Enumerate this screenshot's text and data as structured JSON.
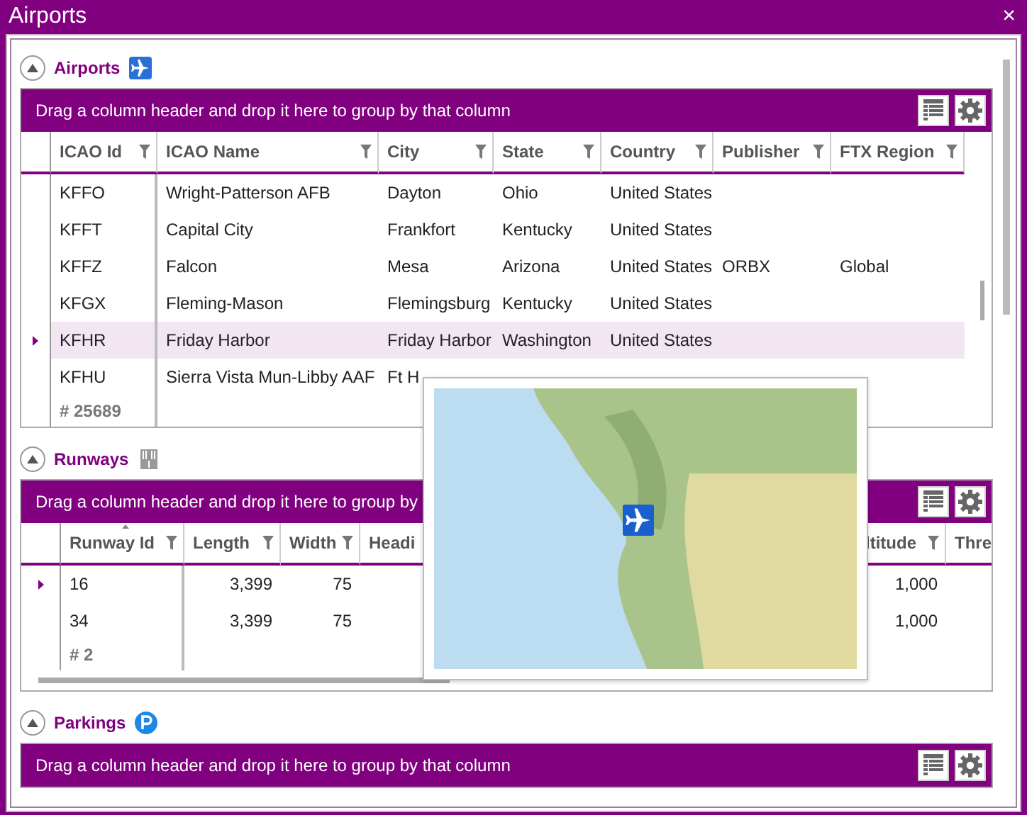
{
  "window": {
    "title": "Airports",
    "close": "×"
  },
  "sections": [
    {
      "title": "Airports",
      "kind": "plane",
      "expanded": true,
      "group_hint": "Drag a column header and drop it here to group by that column",
      "hscroll": false,
      "columns": [
        {
          "label": "ICAO Id",
          "filter": true,
          "sorted": false,
          "numeric": false
        },
        {
          "label": "ICAO Name",
          "filter": true,
          "sorted": false,
          "numeric": false
        },
        {
          "label": "City",
          "filter": true,
          "sorted": false,
          "numeric": false
        },
        {
          "label": "State",
          "filter": true,
          "sorted": false,
          "numeric": false
        },
        {
          "label": "Country",
          "filter": true,
          "sorted": false,
          "numeric": false
        },
        {
          "label": "Publisher",
          "filter": true,
          "sorted": false,
          "numeric": false
        },
        {
          "label": "FTX Region",
          "filter": true,
          "sorted": false,
          "numeric": false
        }
      ],
      "rows": [
        {
          "selected": false,
          "cells": [
            "KFFO",
            "Wright-Patterson AFB",
            "Dayton",
            "Ohio",
            "United States",
            "",
            ""
          ]
        },
        {
          "selected": false,
          "cells": [
            "KFFT",
            "Capital City",
            "Frankfort",
            "Kentucky",
            "United States",
            "",
            ""
          ]
        },
        {
          "selected": false,
          "cells": [
            "KFFZ",
            "Falcon",
            "Mesa",
            "Arizona",
            "United States",
            "ORBX",
            "Global"
          ]
        },
        {
          "selected": false,
          "cells": [
            "KFGX",
            "Fleming-Mason",
            "Flemingsburg",
            "Kentucky",
            "United States",
            "",
            ""
          ]
        },
        {
          "selected": true,
          "cells": [
            "KFHR",
            "Friday Harbor",
            "Friday Harbor",
            "Washington",
            "United States",
            "",
            ""
          ]
        },
        {
          "selected": false,
          "cells": [
            "KFHU",
            "Sierra Vista Mun-Libby AAF",
            "Ft H",
            "",
            "",
            "",
            ""
          ]
        }
      ],
      "footer": "# 25689"
    },
    {
      "title": "Runways",
      "kind": "runway",
      "expanded": true,
      "group_hint": "Drag a column header and drop it here to group by",
      "hscroll": true,
      "columns": [
        {
          "label": "Runway Id",
          "filter": true,
          "sorted": true,
          "numeric": false
        },
        {
          "label": "Length",
          "filter": true,
          "sorted": false,
          "numeric": true
        },
        {
          "label": "Width",
          "filter": true,
          "sorted": false,
          "numeric": true
        },
        {
          "label": "Headi"
        },
        {
          "label": "ltitude",
          "filter": true,
          "sorted": false,
          "numeric": true
        },
        {
          "label": "Thre"
        }
      ],
      "rows": [
        {
          "selected": true,
          "cells": [
            "16",
            "3,399",
            "75",
            "",
            "1,000",
            ""
          ]
        },
        {
          "selected": false,
          "cells": [
            "34",
            "3,399",
            "75",
            "",
            "1,000",
            ""
          ]
        }
      ],
      "footer": "# 2"
    },
    {
      "title": "Parkings",
      "kind": "parking",
      "expanded": true,
      "group_hint": "Drag a column header and drop it here to group by that column",
      "hscroll": false
    }
  ]
}
